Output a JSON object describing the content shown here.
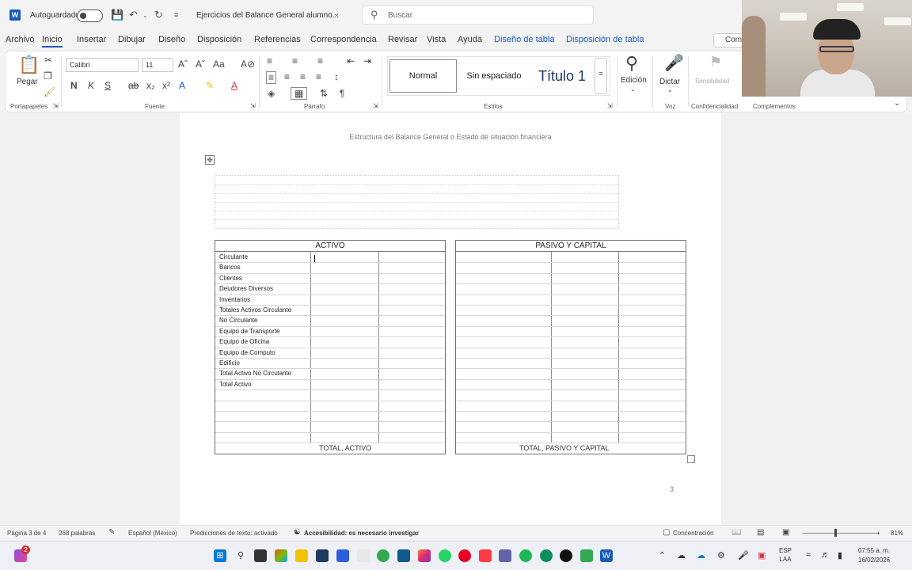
{
  "titlebar": {
    "autosave_label": "Autoguardado",
    "doc_title": "Ejercicios del Balance General alumno...",
    "search_placeholder": "Buscar"
  },
  "tabs": [
    "Archivo",
    "Inicio",
    "Insertar",
    "Dibujar",
    "Diseño",
    "Disposición",
    "Referencias",
    "Correspondencia",
    "Revisar",
    "Vista",
    "Ayuda",
    "Diseño de tabla",
    "Disposición de tabla"
  ],
  "comments_button": "Com",
  "ribbon": {
    "paste_label": "Pegar",
    "font_name": "Calibri",
    "font_size": "11",
    "bold": "N",
    "italic": "K",
    "underline": "S",
    "styles": [
      "Normal",
      "Sin espaciado",
      "Título 1"
    ],
    "edit_label": "Edición",
    "dictate_label": "Dictar",
    "sensitivity_label": "Sensibilidad",
    "groups": [
      "Portapapeles",
      "Fuente",
      "Párrafo",
      "Estilos",
      "Voz",
      "Confidencialidad",
      "Complementos"
    ]
  },
  "document": {
    "header": "Estructura del Balance General o Estado de situación financiera",
    "activo_title": "ACTIVO",
    "pasivo_title": "PASIVO Y CAPITAL",
    "activo_rows": [
      "Circulante",
      "Bancos",
      "Clientes",
      "Deudores Diversos",
      "Inventarios",
      "Totales Activos Circulante",
      "No Circulante",
      "Equipo de Transporte",
      "Equipo de Oficina",
      "Equipo de Computo",
      "Edificio",
      "Total Activo No Circulante",
      "Total Activo"
    ],
    "activo_footer": "TOTAL, ACTIVO",
    "pasivo_footer": "TOTAL, PASIVO Y CAPITAL",
    "page_number": "3"
  },
  "statusbar": {
    "page": "Página 3 de 4",
    "words": "268 palabras",
    "language": "Español (México)",
    "predictions": "Predicciones de texto: activado",
    "accessibility": "Accesibilidad: es necesario investigar",
    "focus": "Concentración",
    "zoom": "81%"
  },
  "taskbar": {
    "badge_count": "2",
    "lang_top": "ESP",
    "lang_bottom": "LAA",
    "time": "07:55 a. m.",
    "date": "16/02/2026"
  },
  "colors": {
    "accent": "#185abd",
    "contextual_tab": "#185abd"
  }
}
